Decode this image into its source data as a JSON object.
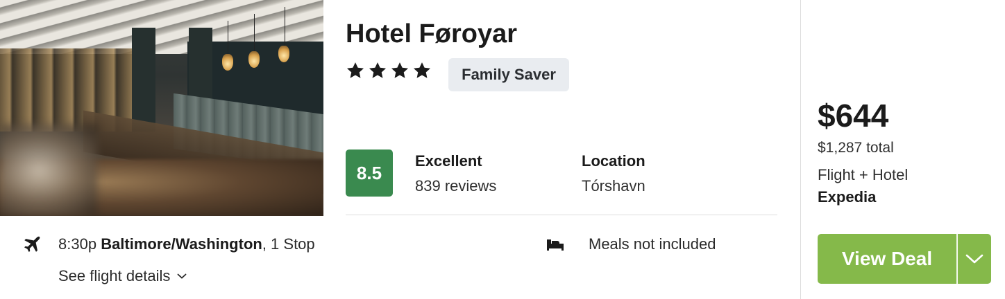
{
  "hotel": {
    "name": "Hotel Føroyar",
    "stars": 4,
    "badge": "Family Saver",
    "photo_icon": "hotel-restaurant-photo"
  },
  "rating": {
    "score": "8.5",
    "label": "Excellent",
    "reviews": "839 reviews",
    "color": "#3a8a4f"
  },
  "location": {
    "label": "Location",
    "value": "Tórshavn"
  },
  "flight": {
    "icon": "airplane-icon",
    "time": "8:30p",
    "airport": "Baltimore/Washington",
    "stops": ", 1 Stop",
    "details_link": "See flight details"
  },
  "meals": {
    "icon": "bed-icon",
    "text": "Meals not included"
  },
  "pricing": {
    "price": "$644",
    "total": "$1,287 total",
    "package": "Flight + Hotel",
    "provider": "Expedia"
  },
  "cta": {
    "label": "View Deal",
    "dropdown_icon": "chevron-down-icon",
    "color": "#85b94a"
  }
}
